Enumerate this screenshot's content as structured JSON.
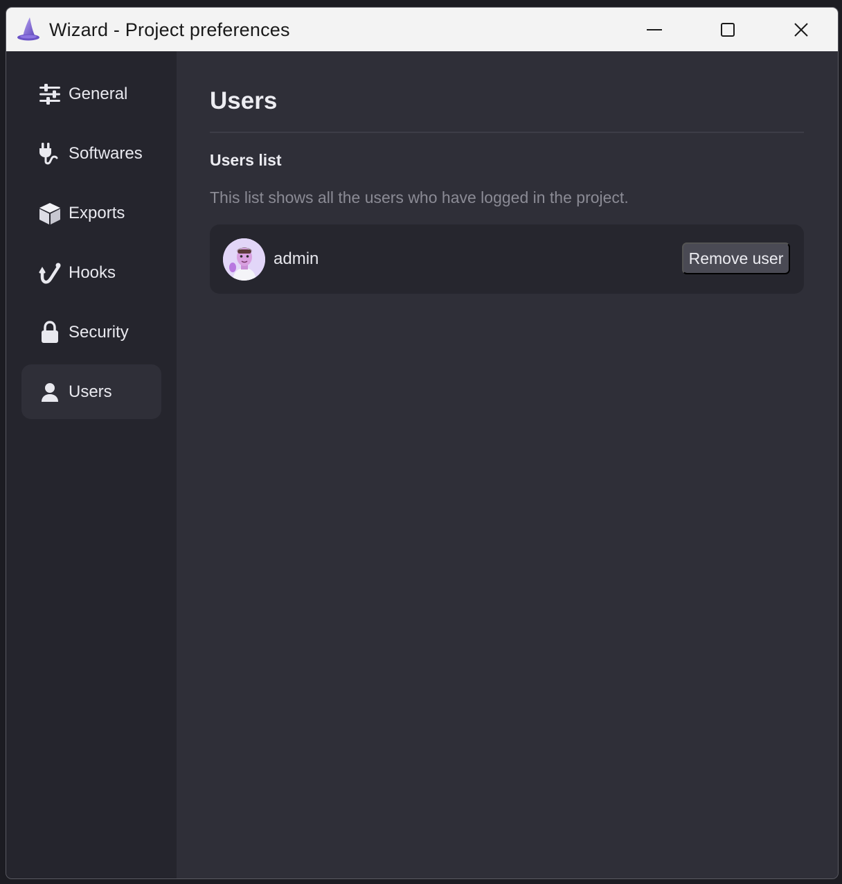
{
  "window": {
    "title": "Wizard - Project preferences",
    "app_icon": "wizard-hat-icon"
  },
  "sidebar": {
    "active": "Users",
    "items": [
      {
        "label": "General",
        "icon": "sliders-icon"
      },
      {
        "label": "Softwares",
        "icon": "plug-icon"
      },
      {
        "label": "Exports",
        "icon": "box-icon"
      },
      {
        "label": "Hooks",
        "icon": "hook-icon"
      },
      {
        "label": "Security",
        "icon": "lock-icon"
      },
      {
        "label": "Users",
        "icon": "user-icon"
      }
    ]
  },
  "main": {
    "title": "Users",
    "section_title": "Users list",
    "section_description": "This list shows all the users who have logged in the project.",
    "users": [
      {
        "name": "admin",
        "avatar": "avatar-icon",
        "action_label": "Remove user"
      }
    ]
  },
  "colors": {
    "titlebar": "#f3f3f3",
    "sidebar": "#25252d",
    "main": "#2f2f38",
    "card": "#26262e",
    "button": "#4a4a54"
  }
}
